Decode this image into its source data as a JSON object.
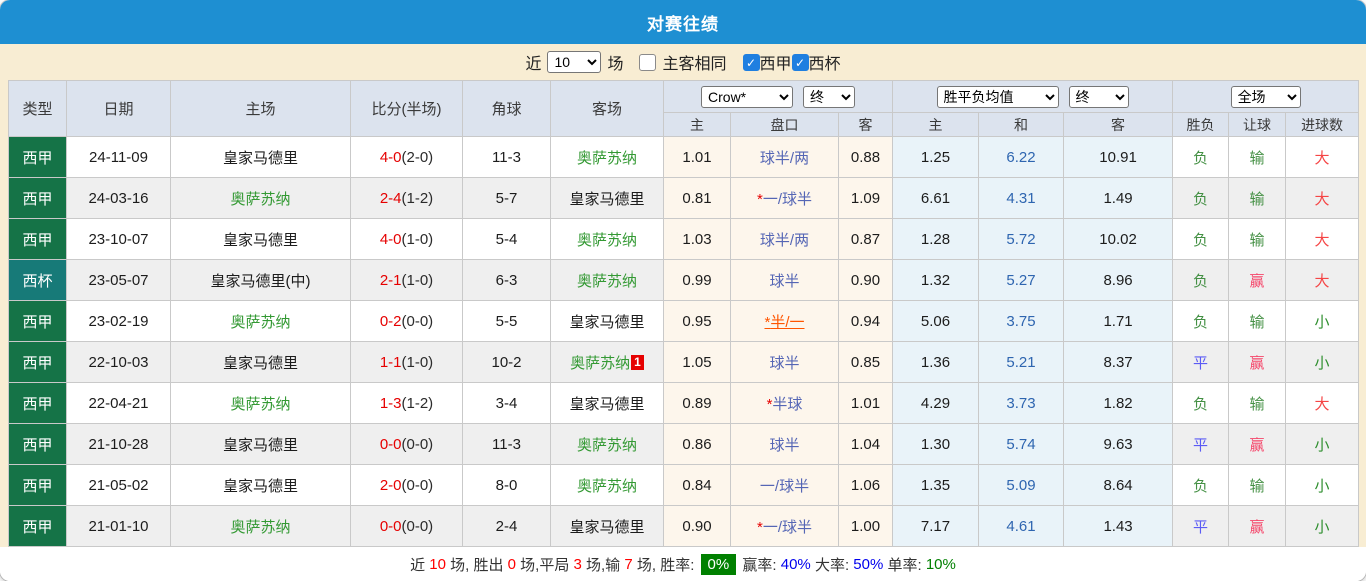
{
  "title": "对赛往绩",
  "theme": {
    "title_bg": "#1e8fd2",
    "bar_bg": "#f8edd3",
    "head_bg": "#dce3ee",
    "league_bg": "#157347",
    "cup_bg": "#177a78",
    "row_alt_bg": "#efefef",
    "odds_col_bg": "#fdf6ec",
    "mean_col_bg": "#e9f3f9",
    "team_green": "#339933",
    "score_red": "#e60000",
    "handicap_blue": "#5566b5",
    "handicap_red": "#ff5500",
    "mean_blue": "#2e65b0",
    "green": "#449044",
    "green2": "#2f8f2f",
    "blue": "#5b5bf5",
    "pink": "#f5476b",
    "red": "#f54545",
    "checkbox_blue": "#1f7fe0",
    "border": "#c9c9c9"
  },
  "filter_bar": {
    "near_label": "近",
    "matches_value": "10",
    "matches_label": "场",
    "same_venue_label": "主客相同",
    "same_venue_checked": false,
    "check_glyph": "✓",
    "league_filters": [
      {
        "label": "西甲",
        "checked": true
      },
      {
        "label": "西杯",
        "checked": true
      }
    ]
  },
  "table": {
    "static_headers": [
      "类型",
      "日期",
      "主场",
      "比分(半场)",
      "角球",
      "客场"
    ],
    "selects": {
      "provider": "Crow*",
      "provider_time": "终",
      "mean": "胜平负均值",
      "mean_time": "终",
      "scope": "全场"
    },
    "sub_headers": [
      "主",
      "盘口",
      "客",
      "主",
      "和",
      "客",
      "胜负",
      "让球",
      "进球数"
    ],
    "value_classes": {
      "负": "green",
      "平": "blue",
      "输": "green",
      "赢": "pink",
      "大": "red",
      "小": "green2"
    },
    "rows": [
      {
        "type": "西甲",
        "type_kind": "league",
        "date": "24-11-09",
        "home": "皇家马德里",
        "home_hl": false,
        "score": "4-0",
        "half": "(2-0)",
        "corners": "11-3",
        "away": "奥萨苏纳",
        "away_hl": true,
        "away_badge": "",
        "odds_home": "1.01",
        "handicap": "球半/两",
        "handicap_star": false,
        "handicap_red": false,
        "odds_away": "0.88",
        "mean_home": "1.25",
        "mean_draw": "6.22",
        "mean_away": "10.91",
        "result": "负",
        "handicap_result": "输",
        "goals": "大"
      },
      {
        "type": "西甲",
        "type_kind": "league",
        "date": "24-03-16",
        "home": "奥萨苏纳",
        "home_hl": true,
        "score": "2-4",
        "half": "(1-2)",
        "corners": "5-7",
        "away": "皇家马德里",
        "away_hl": false,
        "away_badge": "",
        "odds_home": "0.81",
        "handicap": "一/球半",
        "handicap_star": true,
        "handicap_red": false,
        "odds_away": "1.09",
        "mean_home": "6.61",
        "mean_draw": "4.31",
        "mean_away": "1.49",
        "result": "负",
        "handicap_result": "输",
        "goals": "大"
      },
      {
        "type": "西甲",
        "type_kind": "league",
        "date": "23-10-07",
        "home": "皇家马德里",
        "home_hl": false,
        "score": "4-0",
        "half": "(1-0)",
        "corners": "5-4",
        "away": "奥萨苏纳",
        "away_hl": true,
        "away_badge": "",
        "odds_home": "1.03",
        "handicap": "球半/两",
        "handicap_star": false,
        "handicap_red": false,
        "odds_away": "0.87",
        "mean_home": "1.28",
        "mean_draw": "5.72",
        "mean_away": "10.02",
        "result": "负",
        "handicap_result": "输",
        "goals": "大"
      },
      {
        "type": "西杯",
        "type_kind": "cup",
        "date": "23-05-07",
        "home": "皇家马德里(中)",
        "home_hl": false,
        "score": "2-1",
        "half": "(1-0)",
        "corners": "6-3",
        "away": "奥萨苏纳",
        "away_hl": true,
        "away_badge": "",
        "odds_home": "0.99",
        "handicap": "球半",
        "handicap_star": false,
        "handicap_red": false,
        "odds_away": "0.90",
        "mean_home": "1.32",
        "mean_draw": "5.27",
        "mean_away": "8.96",
        "result": "负",
        "handicap_result": "赢",
        "goals": "大"
      },
      {
        "type": "西甲",
        "type_kind": "league",
        "date": "23-02-19",
        "home": "奥萨苏纳",
        "home_hl": true,
        "score": "0-2",
        "half": "(0-0)",
        "corners": "5-5",
        "away": "皇家马德里",
        "away_hl": false,
        "away_badge": "",
        "odds_home": "0.95",
        "handicap": "半/一",
        "handicap_star": true,
        "handicap_red": true,
        "odds_away": "0.94",
        "mean_home": "5.06",
        "mean_draw": "3.75",
        "mean_away": "1.71",
        "result": "负",
        "handicap_result": "输",
        "goals": "小"
      },
      {
        "type": "西甲",
        "type_kind": "league",
        "date": "22-10-03",
        "home": "皇家马德里",
        "home_hl": false,
        "score": "1-1",
        "half": "(1-0)",
        "corners": "10-2",
        "away": "奥萨苏纳",
        "away_hl": true,
        "away_badge": "1",
        "odds_home": "1.05",
        "handicap": "球半",
        "handicap_star": false,
        "handicap_red": false,
        "odds_away": "0.85",
        "mean_home": "1.36",
        "mean_draw": "5.21",
        "mean_away": "8.37",
        "result": "平",
        "handicap_result": "赢",
        "goals": "小"
      },
      {
        "type": "西甲",
        "type_kind": "league",
        "date": "22-04-21",
        "home": "奥萨苏纳",
        "home_hl": true,
        "score": "1-3",
        "half": "(1-2)",
        "corners": "3-4",
        "away": "皇家马德里",
        "away_hl": false,
        "away_badge": "",
        "odds_home": "0.89",
        "handicap": "半球",
        "handicap_star": true,
        "handicap_red": false,
        "odds_away": "1.01",
        "mean_home": "4.29",
        "mean_draw": "3.73",
        "mean_away": "1.82",
        "result": "负",
        "handicap_result": "输",
        "goals": "大"
      },
      {
        "type": "西甲",
        "type_kind": "league",
        "date": "21-10-28",
        "home": "皇家马德里",
        "home_hl": false,
        "score": "0-0",
        "half": "(0-0)",
        "corners": "11-3",
        "away": "奥萨苏纳",
        "away_hl": true,
        "away_badge": "",
        "odds_home": "0.86",
        "handicap": "球半",
        "handicap_star": false,
        "handicap_red": false,
        "odds_away": "1.04",
        "mean_home": "1.30",
        "mean_draw": "5.74",
        "mean_away": "9.63",
        "result": "平",
        "handicap_result": "赢",
        "goals": "小"
      },
      {
        "type": "西甲",
        "type_kind": "league",
        "date": "21-05-02",
        "home": "皇家马德里",
        "home_hl": false,
        "score": "2-0",
        "half": "(0-0)",
        "corners": "8-0",
        "away": "奥萨苏纳",
        "away_hl": true,
        "away_badge": "",
        "odds_home": "0.84",
        "handicap": "一/球半",
        "handicap_star": false,
        "handicap_red": false,
        "odds_away": "1.06",
        "mean_home": "1.35",
        "mean_draw": "5.09",
        "mean_away": "8.64",
        "result": "负",
        "handicap_result": "输",
        "goals": "小"
      },
      {
        "type": "西甲",
        "type_kind": "league",
        "date": "21-01-10",
        "home": "奥萨苏纳",
        "home_hl": true,
        "score": "0-0",
        "half": "(0-0)",
        "corners": "2-4",
        "away": "皇家马德里",
        "away_hl": false,
        "away_badge": "",
        "odds_home": "0.90",
        "handicap": "一/球半",
        "handicap_star": true,
        "handicap_red": false,
        "odds_away": "1.00",
        "mean_home": "7.17",
        "mean_draw": "4.61",
        "mean_away": "1.43",
        "result": "平",
        "handicap_result": "赢",
        "goals": "小"
      }
    ]
  },
  "footer": {
    "segments": [
      {
        "text": "近 ",
        "style": "plain"
      },
      {
        "text": "10",
        "style": "red"
      },
      {
        "text": " 场, 胜出 ",
        "style": "plain"
      },
      {
        "text": "0",
        "style": "red"
      },
      {
        "text": " 场,平局 ",
        "style": "plain"
      },
      {
        "text": "3",
        "style": "red"
      },
      {
        "text": " 场,输 ",
        "style": "plain"
      },
      {
        "text": "7",
        "style": "red"
      },
      {
        "text": " 场, 胜率: ",
        "style": "plain"
      },
      {
        "text": "0%",
        "style": "badge"
      },
      {
        "text": " 赢率: ",
        "style": "plain"
      },
      {
        "text": "40%",
        "style": "blue"
      },
      {
        "text": " 大率: ",
        "style": "plain"
      },
      {
        "text": "50%",
        "style": "blue"
      },
      {
        "text": " 单率: ",
        "style": "plain"
      },
      {
        "text": "10%",
        "style": "green"
      }
    ]
  }
}
